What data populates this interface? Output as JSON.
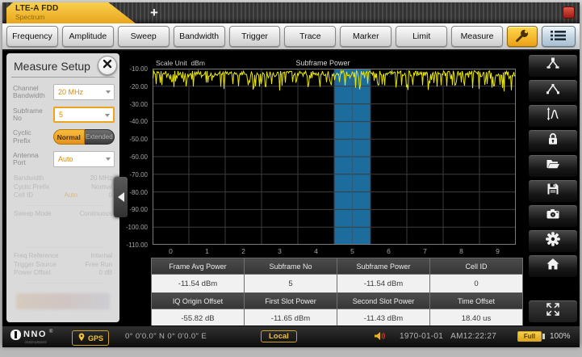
{
  "tabbar": {
    "tab_title": "LTE-A FDD",
    "tab_subtitle": "Spectrum",
    "new_tab_label": "+"
  },
  "toolbar": {
    "buttons": [
      "Frequency",
      "Amplitude",
      "Sweep",
      "Bandwidth",
      "Trigger",
      "Trace",
      "Marker",
      "Limit",
      "Measure"
    ]
  },
  "measure_setup": {
    "title": "Measure Setup",
    "channel_bandwidth": {
      "label1": "Channel",
      "label2": "Bandwidth",
      "value": "20 MHz"
    },
    "subframe_no": {
      "label1": "Subframe",
      "label2": "No",
      "value": "5"
    },
    "cyclic_prefix": {
      "label1": "Cyclic",
      "label2": "Prefix",
      "option_on": "Normal",
      "option_off": "Extended"
    },
    "antenna_port": {
      "label1": "Antenna",
      "label2": "Port",
      "value": "Auto"
    },
    "disabled_info": {
      "section1": [
        {
          "label": "Bandwidth",
          "value": "20 MHz"
        },
        {
          "label": "Cyclic Prefix",
          "value": "Normal"
        },
        {
          "label": "Cell ID",
          "tag": "Auto",
          "value": "0"
        }
      ],
      "section2": [
        {
          "label": "Sweep Mode",
          "value": "Continuous"
        }
      ],
      "section3": [
        {
          "label": "Freq Reference",
          "value": "Internal"
        },
        {
          "label": "Trigger Source",
          "value": "Free Run"
        },
        {
          "label": "Power Offset",
          "value": "0 dB"
        }
      ]
    }
  },
  "chart_data": {
    "type": "line",
    "title": "Subframe Power",
    "scale_unit_label": "Scale Unit",
    "scale_unit_value": "dBm",
    "ylabel": "dBm",
    "ylim": [
      -110,
      -10
    ],
    "y_ticks": [
      "-10.00",
      "-20.00",
      "-30.00",
      "-40.00",
      "-50.00",
      "-60.00",
      "-70.00",
      "-80.00",
      "-90.00",
      "-100.00",
      "-110.00"
    ],
    "x_ticks": [
      "0",
      "1",
      "2",
      "3",
      "4",
      "5",
      "6",
      "7",
      "8",
      "9"
    ],
    "grid": true,
    "highlight_subframe": 5,
    "highlight_color": "#1d6c9e",
    "trace_color": "#e9e600",
    "trace": {
      "seed": 987654321,
      "base_dbm": -11.2,
      "noise_db": 3,
      "spike_chance": 0.3,
      "spike_db": 9,
      "points": 450
    },
    "measured": {
      "frame_avg_power_dbm": -11.54,
      "subframe_no": 5,
      "subframe_power_dbm": -11.54,
      "cell_id": 0,
      "iq_origin_offset_db": -55.82,
      "first_slot_power_dbm": -11.65,
      "second_slot_power_dbm": -11.43,
      "time_offset_us": 18.4
    }
  },
  "results_table": {
    "rows": [
      {
        "type": "header",
        "cells": [
          "Frame Avg Power",
          "Subframe No",
          "Subframe Power",
          "Cell ID"
        ]
      },
      {
        "type": "value",
        "cells": [
          "-11.54 dBm",
          "5",
          "-11.54 dBm",
          "0"
        ]
      },
      {
        "type": "header",
        "cells": [
          "IQ Origin Offset",
          "First Slot Power",
          "Second Slot Power",
          "Time Offset"
        ]
      },
      {
        "type": "value",
        "cells": [
          "-55.82 dB",
          "-11.65 dBm",
          "-11.43 dBm",
          "18.40 us"
        ]
      }
    ]
  },
  "sidebar": {
    "icons": [
      "peak-marker",
      "next-peak",
      "auto-scale",
      "lock",
      "open-folder",
      "save",
      "camera",
      "settings",
      "home",
      "fullscreen"
    ]
  },
  "statusbar": {
    "logo_text": "NNO",
    "logo_reg": "®",
    "logo_subtext": "instrument",
    "gps_label": "GPS",
    "coordinates": "0° 0'0.0\" N 0° 0'0.0\" E",
    "local_label": "Local",
    "date": "1970-01-01",
    "time": "AM12:22:27",
    "battery_label": "Full",
    "battery_percent": "100%"
  }
}
